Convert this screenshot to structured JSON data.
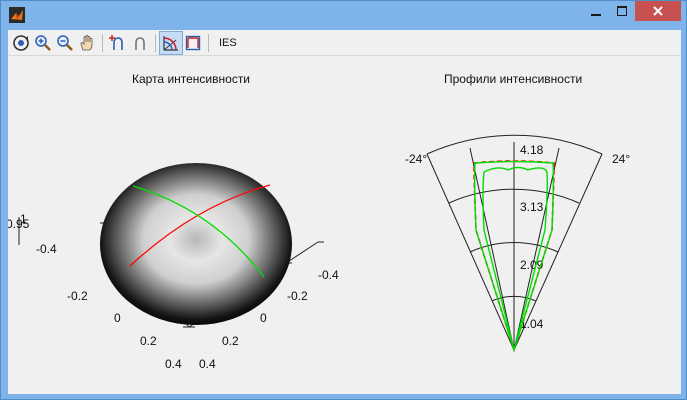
{
  "window": {
    "title": ""
  },
  "toolbar": {
    "buttons": [
      {
        "icon": "rotate-3d-icon"
      },
      {
        "icon": "zoom-in-icon"
      },
      {
        "icon": "zoom-out-icon"
      },
      {
        "icon": "pan-hand-icon"
      },
      {
        "icon": "data-cursor-icon"
      },
      {
        "icon": "data-cursor-off-icon"
      },
      {
        "icon": "polar-plot-icon",
        "active": true
      },
      {
        "icon": "cartesian-plot-icon"
      }
    ],
    "ies_label": "IES"
  },
  "left_plot": {
    "title": "Карта интенсивности",
    "z_ticks": [
      "1",
      "0.95"
    ],
    "axis1_ticks": [
      "-0.4",
      "-0.2",
      "0",
      "0.2",
      "0.4"
    ],
    "axis2_ticks": [
      "-0.4",
      "-0.2",
      "0",
      "0.2",
      "0.4"
    ]
  },
  "right_plot": {
    "title": "Профили интенсивности",
    "angle_left": "-24°",
    "angle_right": "24°",
    "radial_ticks": [
      "4.18",
      "3.13",
      "2.09",
      "1.04"
    ]
  },
  "colors": {
    "red_curve": "#ff0000",
    "green_curve": "#00dd00"
  }
}
